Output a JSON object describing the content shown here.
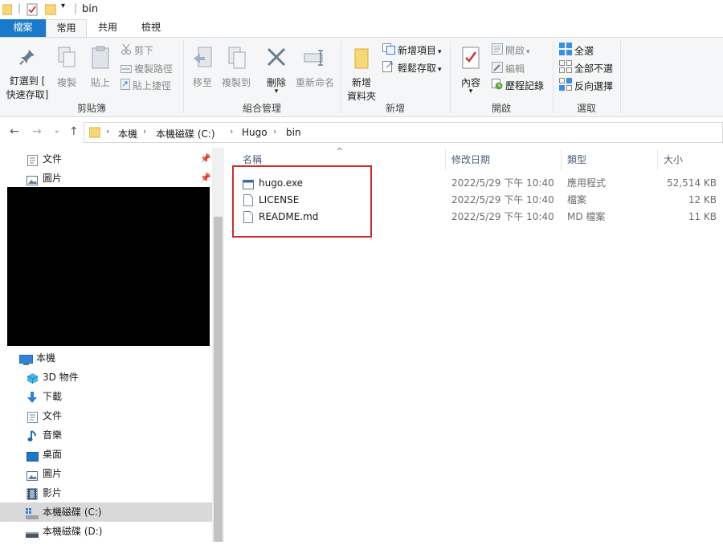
{
  "window": {
    "title": "bin"
  },
  "tabs": {
    "file": "檔案",
    "home": "常用",
    "share": "共用",
    "view": "檢視"
  },
  "ribbon": {
    "clipboard": {
      "label": "剪貼簿",
      "pin_quick_access_line1": "釘選到 [",
      "pin_quick_access_line2": "快速存取]",
      "copy": "複製",
      "paste": "貼上",
      "cut": "剪下",
      "copy_path": "複製路徑",
      "paste_shortcut": "貼上捷徑"
    },
    "organize": {
      "label": "組合管理",
      "move_to": "移至",
      "copy_to": "複製到",
      "delete": "刪除",
      "rename": "重新命名"
    },
    "new": {
      "label": "新增",
      "new_folder_line1": "新增",
      "new_folder_line2": "資料夾",
      "new_item": "新增項目",
      "easy_access": "輕鬆存取"
    },
    "open": {
      "label": "開啟",
      "properties": "內容",
      "open": "開啟",
      "edit": "編輯",
      "history": "歷程記錄"
    },
    "select": {
      "label": "選取",
      "select_all": "全選",
      "select_none": "全部不選",
      "invert": "反向選擇"
    }
  },
  "address": {
    "crumbs": [
      "本機",
      "本機磁碟 (C:)",
      "Hugo",
      "bin"
    ]
  },
  "nav": {
    "quick_access": [
      {
        "label": "文件"
      },
      {
        "label": "圖片"
      }
    ],
    "this_pc": "本機",
    "pc_items": [
      {
        "label": "3D 物件"
      },
      {
        "label": "下載"
      },
      {
        "label": "文件"
      },
      {
        "label": "音樂"
      },
      {
        "label": "桌面"
      },
      {
        "label": "圖片"
      },
      {
        "label": "影片"
      },
      {
        "label": "本機磁碟 (C:)"
      },
      {
        "label": "本機磁碟 (D:)"
      }
    ]
  },
  "filelist": {
    "columns": {
      "name": "名稱",
      "modified": "修改日期",
      "type": "類型",
      "size": "大小"
    },
    "files": [
      {
        "name": "hugo.exe",
        "modified": "2022/5/29 下午 10:40",
        "type": "應用程式",
        "size": "52,514 KB"
      },
      {
        "name": "LICENSE",
        "modified": "2022/5/29 下午 10:40",
        "type": "檔案",
        "size": "12 KB"
      },
      {
        "name": "README.md",
        "modified": "2022/5/29 下午 10:40",
        "type": "MD 檔案",
        "size": "11 KB"
      }
    ]
  },
  "colors": {
    "accent": "#1979ca",
    "highlight_box": "#d22b2b",
    "folder": "#f8d775"
  }
}
